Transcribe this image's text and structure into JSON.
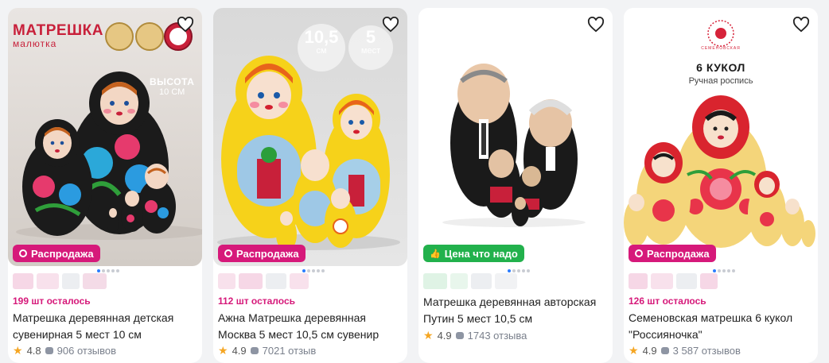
{
  "cards": [
    {
      "badge": "Распродажа",
      "badge_color": "#d6197a",
      "stock": "199 шт осталось",
      "title": "Матрешка деревянная детская сувенирная 5 мест 10 см",
      "rating": "4.8",
      "reviews": "906 отзывов",
      "brand": "МАТРЕШКА",
      "brand_sub": "малютка",
      "height_label": "ВЫСОТА",
      "height_value": "10 СМ"
    },
    {
      "badge": "Распродажа",
      "badge_color": "#d6197a",
      "stock": "112 шт осталось",
      "title": "Ажна Матрешка деревянная Москва 5 мест 10,5 см сувенир",
      "rating": "4.9",
      "reviews": "7021 отзыв",
      "size_value": "10,5",
      "size_unit": "см",
      "places_value": "5",
      "places_unit": "мест"
    },
    {
      "badge": "Цена что надо",
      "badge_color": "#22b14c",
      "stock": "",
      "title": "Матрешка деревянная авторская Путин 5 мест 10,5 см",
      "rating": "4.9",
      "reviews": "1743 отзыва"
    },
    {
      "badge": "Распродажа",
      "badge_color": "#d6197a",
      "stock": "126 шт осталось",
      "title": "Семеновская матрешка 6 кукол \"Россияночка\"",
      "rating": "4.9",
      "reviews": "3 587 отзывов",
      "count_title": "6 КУКОЛ",
      "count_sub": "Ручная роспись",
      "brand_ring": "СЕМЕНОВСКАЯ"
    }
  ]
}
